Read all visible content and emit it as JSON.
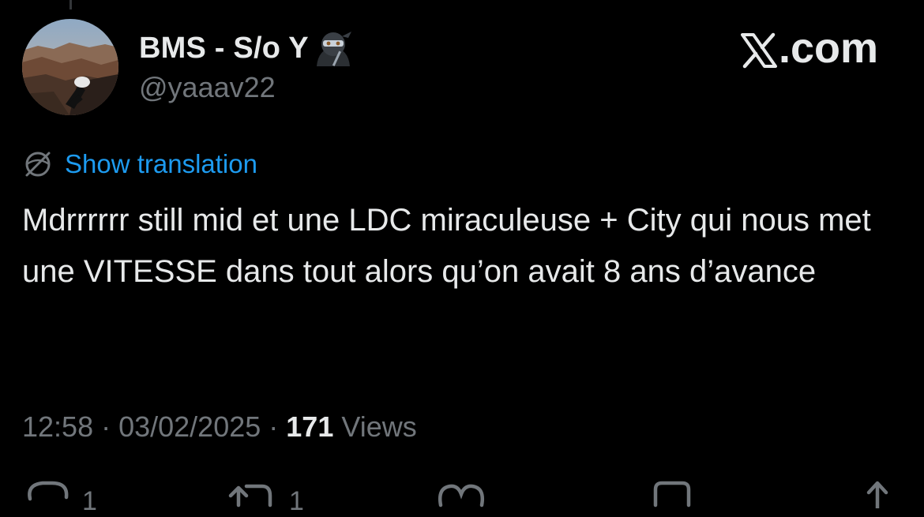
{
  "author": {
    "display_name": "BMS - S/o Y",
    "emoji_icon": "ninja-icon",
    "handle": "@yaaav22",
    "avatar": "avatar-photo-canyon"
  },
  "brand": {
    "text": ".com",
    "logo": "x-logo-icon"
  },
  "translation": {
    "label": "Show translation",
    "icon": "globe-icon"
  },
  "tweet": {
    "text": "Mdrrrrrr still mid et une LDC miraculeuse + City qui nous met une VITESSE dans tout alors qu’on avait 8 ans d’avance"
  },
  "meta": {
    "time": "12:58",
    "separator": " · ",
    "date": "03/02/2025",
    "views_count": "171",
    "views_label": " Views"
  },
  "actions": {
    "reply_count": "1",
    "repost_count": "1"
  },
  "colors": {
    "background": "#000000",
    "text": "#e7e9ea",
    "secondary": "#71767b",
    "accent": "#1d9bf0"
  }
}
